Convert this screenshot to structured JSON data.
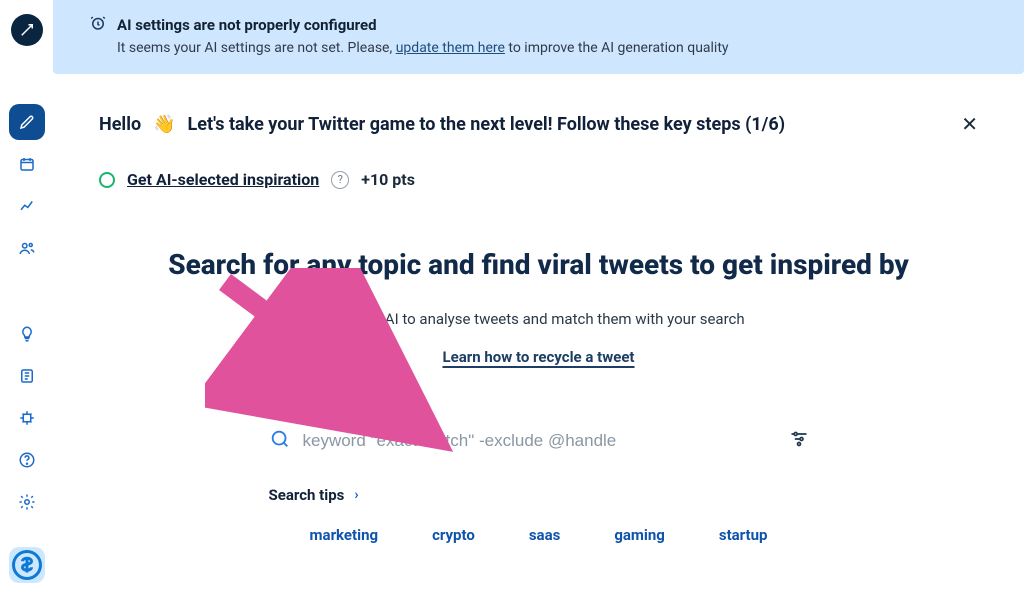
{
  "alert": {
    "title": "AI settings are not properly configured",
    "body_prefix": "It seems your AI settings are not set. Please, ",
    "link": "update them here",
    "body_suffix": " to improve the AI generation quality"
  },
  "onboard": {
    "hello": "Hello",
    "wave": "👋",
    "message": "Let's take your Twitter game to the next level! Follow these key steps (1/6)",
    "task_label": "Get AI-selected inspiration",
    "task_points": "+10 pts"
  },
  "hero": {
    "title": "Search for any topic and find viral tweets to get inspired by",
    "subtitle": "We use AI to analyse tweets and match them with your search",
    "learn_link": "Learn how to recycle a tweet",
    "search_placeholder": "keyword \"exact match\" -exclude @handle",
    "tips_label": "Search tips"
  },
  "tags": [
    "marketing",
    "crypto",
    "saas",
    "gaming",
    "startup"
  ],
  "colors": {
    "alert_bg": "#cfe6ff",
    "accent_blue": "#0f4d92",
    "arrow_pink": "#e0529b"
  }
}
